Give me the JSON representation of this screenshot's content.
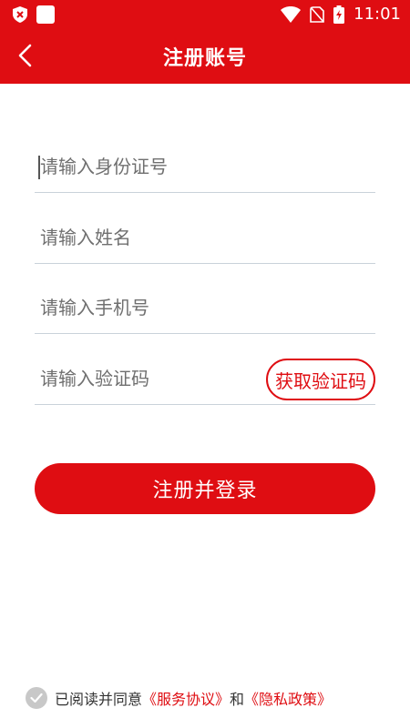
{
  "status_bar": {
    "time": "11:01"
  },
  "header": {
    "title": "注册账号"
  },
  "form": {
    "id_placeholder": "请输入身份证号",
    "name_placeholder": "请输入姓名",
    "phone_placeholder": "请输入手机号",
    "code_placeholder": "请输入验证码",
    "get_code_label": "获取验证码",
    "submit_label": "注册并登录"
  },
  "agreement": {
    "prefix": "已阅读并同意",
    "service_link": "《服务协议》",
    "and": "和",
    "privacy_link": "《隐私政策》"
  },
  "colors": {
    "brand": "#df0d12",
    "divider": "#c9d2da"
  }
}
